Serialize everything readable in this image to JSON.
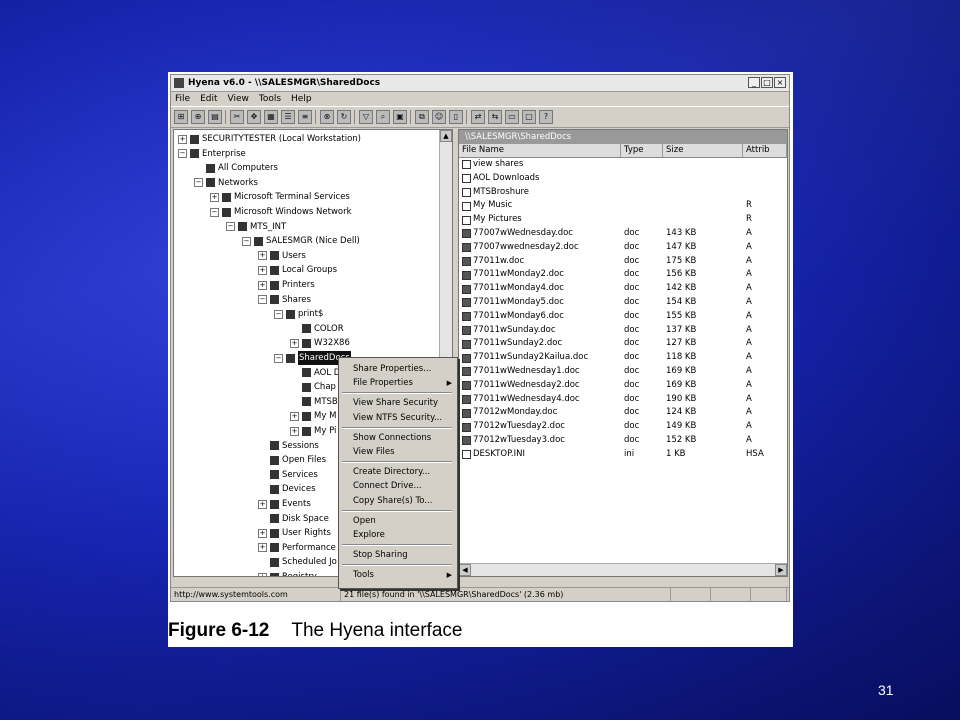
{
  "window": {
    "title": "Hyena v6.0 - \\\\SALESMGR\\SharedDocs",
    "controls": [
      "_",
      "□",
      "×"
    ]
  },
  "menu": [
    "File",
    "Edit",
    "View",
    "Tools",
    "Help"
  ],
  "tree": [
    {
      "label": "SECURITYTESTER (Local Workstation)",
      "exp": "+"
    },
    {
      "label": "Enterprise",
      "exp": "−"
    },
    {
      "label": "All Computers",
      "exp": ""
    },
    {
      "label": "Networks",
      "exp": "−"
    },
    {
      "label": "Microsoft Terminal Services",
      "exp": "+"
    },
    {
      "label": "Microsoft Windows Network",
      "exp": "−"
    },
    {
      "label": "MTS_INT",
      "exp": "−"
    },
    {
      "label": "SALESMGR (Nice Dell)",
      "exp": "−"
    },
    {
      "label": "Users",
      "exp": "+"
    },
    {
      "label": "Local Groups",
      "exp": "+"
    },
    {
      "label": "Printers",
      "exp": "+"
    },
    {
      "label": "Shares",
      "exp": "−"
    },
    {
      "label": "print$",
      "exp": "−"
    },
    {
      "label": "COLOR",
      "exp": ""
    },
    {
      "label": "W32X86",
      "exp": "+"
    },
    {
      "label": "SharedDocs",
      "exp": "−"
    },
    {
      "label": "AOL D",
      "exp": ""
    },
    {
      "label": "Chap",
      "exp": ""
    },
    {
      "label": "MTSB",
      "exp": ""
    },
    {
      "label": "My M",
      "exp": "+"
    },
    {
      "label": "My Pi",
      "exp": "+"
    },
    {
      "label": "Sessions",
      "exp": ""
    },
    {
      "label": "Open Files",
      "exp": ""
    },
    {
      "label": "Services",
      "exp": ""
    },
    {
      "label": "Devices",
      "exp": ""
    },
    {
      "label": "Events",
      "exp": "+"
    },
    {
      "label": "Disk Space",
      "exp": ""
    },
    {
      "label": "User Rights",
      "exp": "+"
    },
    {
      "label": "Performance",
      "exp": "+"
    },
    {
      "label": "Scheduled Jo",
      "exp": ""
    },
    {
      "label": "Registry",
      "exp": "+"
    }
  ],
  "list": {
    "title": "\\\\SALESMGR\\SharedDocs",
    "headers": {
      "name": "File Name",
      "type": "Type",
      "size": "Size",
      "attrib": "Attrib"
    },
    "files": [
      {
        "name": "view shares",
        "type": "",
        "size": "",
        "attrib": ""
      },
      {
        "name": "AOL Downloads",
        "type": "",
        "size": "",
        "attrib": ""
      },
      {
        "name": "MTSBroshure",
        "type": "",
        "size": "",
        "attrib": ""
      },
      {
        "name": "My Music",
        "type": "",
        "size": "",
        "attrib": "R"
      },
      {
        "name": "My Pictures",
        "type": "",
        "size": "",
        "attrib": "R"
      },
      {
        "name": "77007wWednesday.doc",
        "type": "doc",
        "size": "143 KB",
        "attrib": "A"
      },
      {
        "name": "77007wwednesday2.doc",
        "type": "doc",
        "size": "147 KB",
        "attrib": "A"
      },
      {
        "name": "77011w.doc",
        "type": "doc",
        "size": "175 KB",
        "attrib": "A"
      },
      {
        "name": "77011wMonday2.doc",
        "type": "doc",
        "size": "156 KB",
        "attrib": "A"
      },
      {
        "name": "77011wMonday4.doc",
        "type": "doc",
        "size": "142 KB",
        "attrib": "A"
      },
      {
        "name": "77011wMonday5.doc",
        "type": "doc",
        "size": "154 KB",
        "attrib": "A"
      },
      {
        "name": "77011wMonday6.doc",
        "type": "doc",
        "size": "155 KB",
        "attrib": "A"
      },
      {
        "name": "77011wSunday.doc",
        "type": "doc",
        "size": "137 KB",
        "attrib": "A"
      },
      {
        "name": "77011wSunday2.doc",
        "type": "doc",
        "size": "127 KB",
        "attrib": "A"
      },
      {
        "name": "77011wSunday2Kailua.doc",
        "type": "doc",
        "size": "118 KB",
        "attrib": "A"
      },
      {
        "name": "77011wWednesday1.doc",
        "type": "doc",
        "size": "169 KB",
        "attrib": "A"
      },
      {
        "name": "77011wWednesday2.doc",
        "type": "doc",
        "size": "169 KB",
        "attrib": "A"
      },
      {
        "name": "77011wWednesday4.doc",
        "type": "doc",
        "size": "190 KB",
        "attrib": "A"
      },
      {
        "name": "77012wMonday.doc",
        "type": "doc",
        "size": "124 KB",
        "attrib": "A"
      },
      {
        "name": "77012wTuesday2.doc",
        "type": "doc",
        "size": "149 KB",
        "attrib": "A"
      },
      {
        "name": "77012wTuesday3.doc",
        "type": "doc",
        "size": "152 KB",
        "attrib": "A"
      },
      {
        "name": "DESKTOP.INI",
        "type": "ini",
        "size": "1 KB",
        "attrib": "HSA"
      }
    ]
  },
  "context_menu": [
    {
      "label": "Share Properties...",
      "group": 0
    },
    {
      "label": "File Properties",
      "group": 0,
      "submenu": true
    },
    {
      "label": "View Share Security",
      "group": 1
    },
    {
      "label": "View NTFS Security...",
      "group": 1
    },
    {
      "label": "Show Connections",
      "group": 2
    },
    {
      "label": "View Files",
      "group": 2
    },
    {
      "label": "Create Directory...",
      "group": 3
    },
    {
      "label": "Connect Drive...",
      "group": 3
    },
    {
      "label": "Copy Share(s) To...",
      "group": 3
    },
    {
      "label": "Open",
      "group": 4
    },
    {
      "label": "Explore",
      "group": 4
    },
    {
      "label": "Stop Sharing",
      "group": 5
    },
    {
      "label": "Tools",
      "group": 6,
      "submenu": true
    }
  ],
  "status": {
    "url": "http://www.systemtools.com",
    "summary": "21 file(s) found in '\\\\SALESMGR\\SharedDocs' (2.36 mb)"
  },
  "caption": {
    "label": "Figure 6-12",
    "text": "The Hyena interface"
  },
  "page_number": "31"
}
